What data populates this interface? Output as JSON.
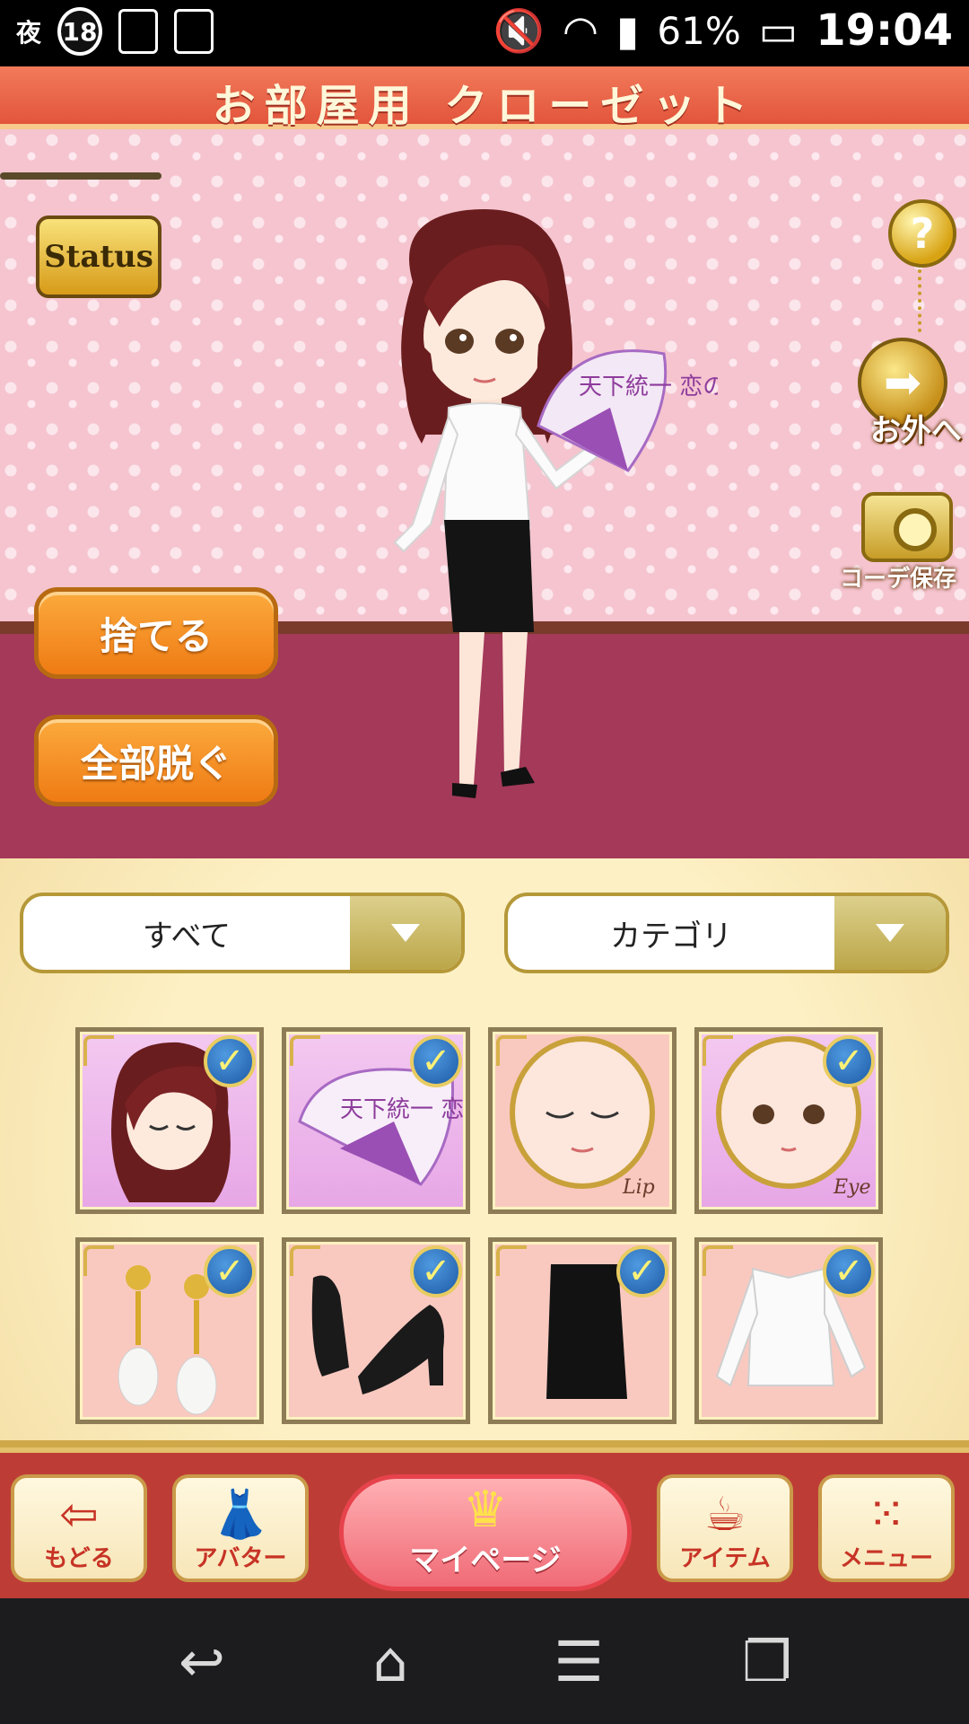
{
  "status_bar": {
    "night_label": "夜",
    "rating": "18",
    "battery": "61%",
    "time": "19:04"
  },
  "title": "お部屋用 クローゼット",
  "room": {
    "status_sign": "Status",
    "help": "?",
    "outside_label": "お外へ",
    "save_coord_label": "コーデ保存",
    "discard_label": "捨てる",
    "undress_label": "全部脱ぐ",
    "fan_text": "天下統一 恋の乱"
  },
  "closet": {
    "filter_value": "すべて",
    "category_value": "カテゴリ",
    "items": [
      {
        "name": "hair",
        "bg": "lavender",
        "checked": true
      },
      {
        "name": "fan",
        "bg": "lavender",
        "checked": true,
        "text": "天下統一 恋の乱"
      },
      {
        "name": "lip",
        "bg": "pink",
        "checked": false,
        "text": "Lip"
      },
      {
        "name": "eye",
        "bg": "lavender",
        "checked": true,
        "text": "Eye"
      },
      {
        "name": "earrings",
        "bg": "pink",
        "checked": true
      },
      {
        "name": "heels",
        "bg": "pink",
        "checked": true
      },
      {
        "name": "skirt",
        "bg": "pink",
        "checked": true
      },
      {
        "name": "blouse",
        "bg": "pink",
        "checked": true
      }
    ]
  },
  "bottom_nav": {
    "back": "もどる",
    "avatar": "アバター",
    "mypage": "マイページ",
    "item": "アイテム",
    "menu": "メニュー"
  }
}
